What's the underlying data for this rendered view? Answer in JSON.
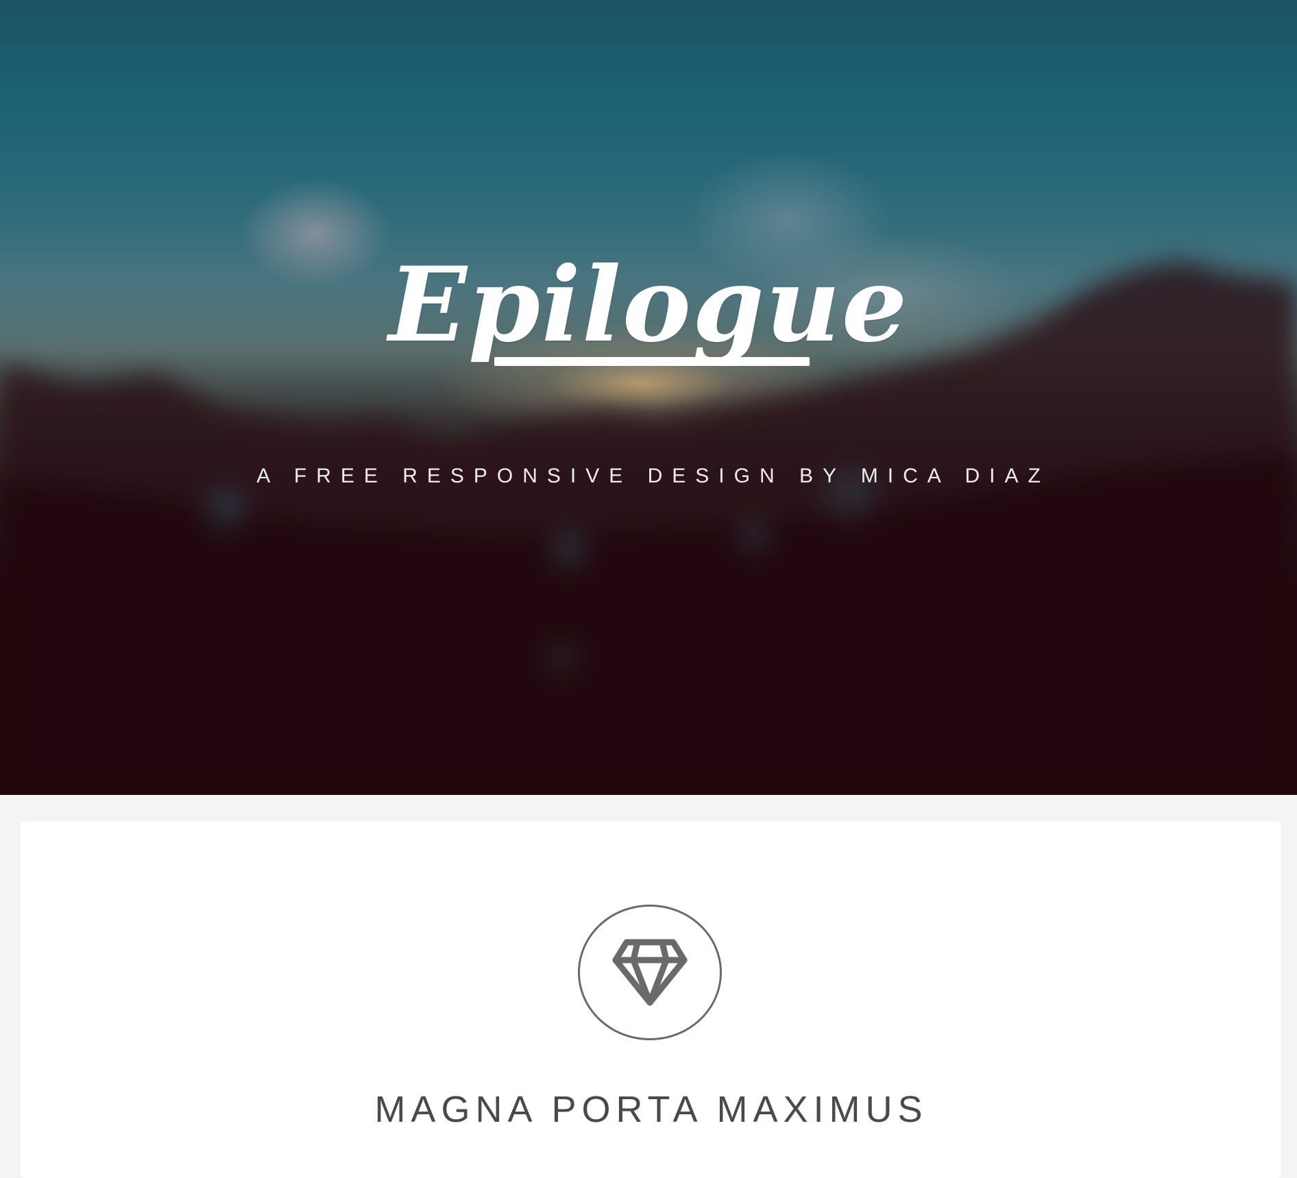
{
  "hero": {
    "logo_text": "Epilogue",
    "tagline": "A FREE RESPONSIVE DESIGN BY MICA DIAZ"
  },
  "feature": {
    "icon": "diamond-icon",
    "title": "MAGNA PORTA MAXIMUS"
  },
  "colors": {
    "page_background": "#f4f4f4",
    "card_background": "#ffffff",
    "icon_stroke": "#6a6a6a",
    "title_text": "#4a4a4a",
    "hero_text": "#ffffff"
  }
}
